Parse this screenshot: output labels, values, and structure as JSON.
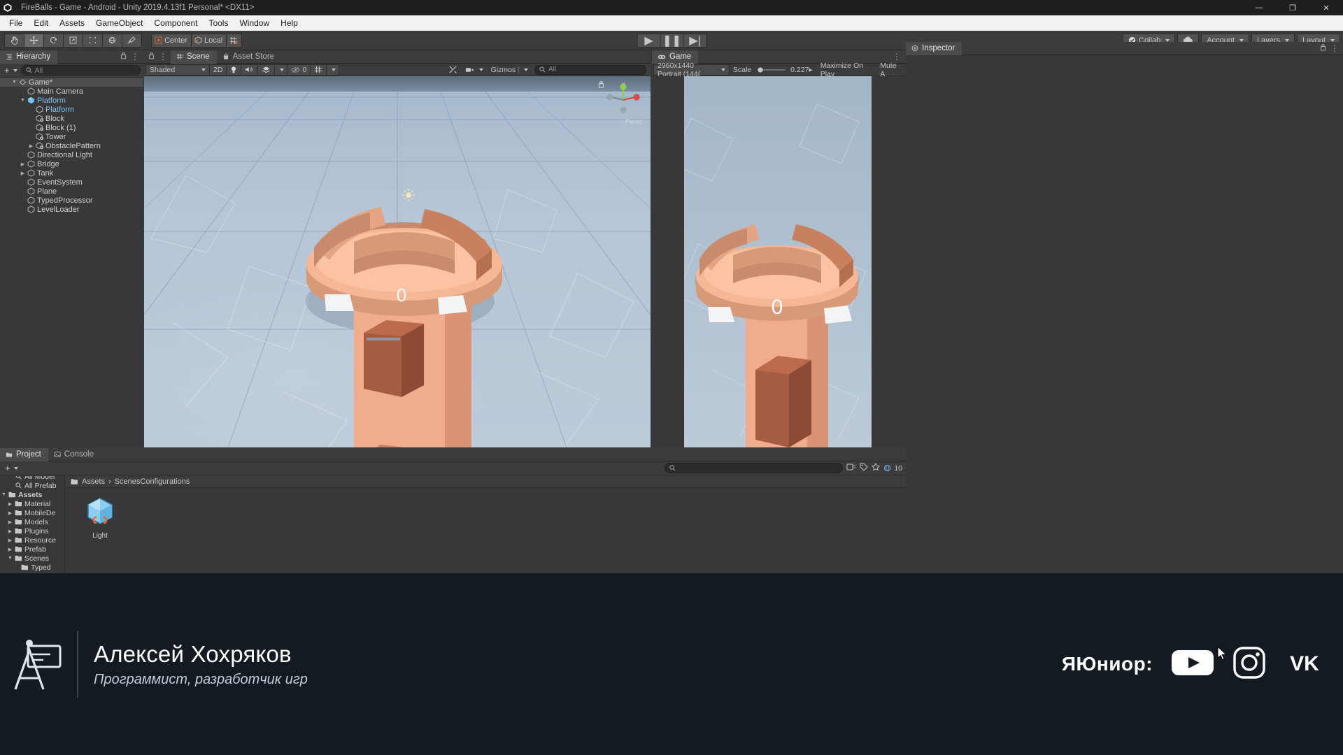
{
  "window": {
    "title": "FireBalls - Game - Android - Unity 2019.4.13f1 Personal* <DX11>",
    "app_icon": "unity-icon",
    "minimize": "—",
    "maximize": "❐",
    "close": "✕"
  },
  "menubar": {
    "items": [
      "File",
      "Edit",
      "Assets",
      "GameObject",
      "Component",
      "Tools",
      "Window",
      "Help"
    ]
  },
  "toolbar": {
    "tools": [
      {
        "name": "hand-tool-icon",
        "glyph": "✋"
      },
      {
        "name": "move-tool-icon",
        "glyph": "✥"
      },
      {
        "name": "rotate-tool-icon",
        "glyph": "↻"
      },
      {
        "name": "scale-tool-icon",
        "glyph": "⇲"
      },
      {
        "name": "rect-tool-icon",
        "glyph": "⬚"
      },
      {
        "name": "transform-tool-icon",
        "glyph": "⌘"
      },
      {
        "name": "custom-tool-icon",
        "glyph": "⚒"
      }
    ],
    "pivot_label": "Center",
    "space_label": "Local",
    "grid_snap_icon": "grid-snap-icon",
    "play": "▶",
    "pause": "❚❚",
    "step": "▶|",
    "collab_label": "Collab",
    "cloud_icon": "cloud-icon",
    "account_label": "Account",
    "layers_label": "Layers",
    "layout_label": "Layout"
  },
  "hierarchy": {
    "tab_label": "Hierarchy",
    "tab_icon": "hierarchy-icon",
    "add_label": "+",
    "search_placeholder": "All",
    "items": [
      {
        "label": "Game*",
        "depth": 0,
        "icon": "scene-icon",
        "arrow": "down",
        "selected": true,
        "prefab": false
      },
      {
        "label": "Main Camera",
        "depth": 1,
        "icon": "gameobject-icon",
        "arrow": "none",
        "selected": false,
        "prefab": false
      },
      {
        "label": "Platform",
        "depth": 1,
        "icon": "prefab-icon",
        "arrow": "down",
        "selected": false,
        "prefab": true
      },
      {
        "label": "Platform",
        "depth": 2,
        "icon": "gameobject-icon",
        "arrow": "none",
        "selected": false,
        "prefab": true
      },
      {
        "label": "Block",
        "depth": 2,
        "icon": "prefab-child-icon",
        "arrow": "none",
        "selected": false,
        "prefab": false
      },
      {
        "label": "Block (1)",
        "depth": 2,
        "icon": "prefab-child-icon",
        "arrow": "none",
        "selected": false,
        "prefab": false
      },
      {
        "label": "Tower",
        "depth": 2,
        "icon": "prefab-child-icon",
        "arrow": "none",
        "selected": false,
        "prefab": false
      },
      {
        "label": "ObstaclePattern",
        "depth": 2,
        "icon": "prefab-child-icon",
        "arrow": "right",
        "selected": false,
        "prefab": false
      },
      {
        "label": "Directional Light",
        "depth": 1,
        "icon": "gameobject-icon",
        "arrow": "none",
        "selected": false,
        "prefab": false
      },
      {
        "label": "Bridge",
        "depth": 1,
        "icon": "gameobject-icon",
        "arrow": "right",
        "selected": false,
        "prefab": false
      },
      {
        "label": "Tank",
        "depth": 1,
        "icon": "gameobject-icon",
        "arrow": "right",
        "selected": false,
        "prefab": false
      },
      {
        "label": "EventSystem",
        "depth": 1,
        "icon": "gameobject-icon",
        "arrow": "none",
        "selected": false,
        "prefab": false
      },
      {
        "label": "Plane",
        "depth": 1,
        "icon": "gameobject-icon",
        "arrow": "none",
        "selected": false,
        "prefab": false
      },
      {
        "label": "TypedProcessor",
        "depth": 1,
        "icon": "gameobject-icon",
        "arrow": "none",
        "selected": false,
        "prefab": false
      },
      {
        "label": "LevelLoader",
        "depth": 1,
        "icon": "gameobject-icon",
        "arrow": "none",
        "selected": false,
        "prefab": false
      }
    ]
  },
  "scene": {
    "tabs": [
      {
        "label": "Scene",
        "icon": "scene-tab-icon",
        "selected": true
      },
      {
        "label": "Asset Store",
        "icon": "asset-store-icon",
        "selected": false
      }
    ],
    "draw_mode": "Shaded",
    "mode_2d": "2D",
    "lighting_icon": "light-bulb-icon",
    "audio_icon": "audio-icon",
    "fx_icon": "effects-icon",
    "visibility_icon": "visibility-off-icon",
    "hidden_count": "0",
    "grid_icon": "grid-icon",
    "tools_icon": "scene-tools-icon",
    "camera_icon": "scene-camera-icon",
    "gizmos_label": "Gizmos",
    "search_placeholder": "All",
    "gizmo_axis_y": "y",
    "persp_label": "Persp",
    "overlay_number": "0"
  },
  "game": {
    "tab_label": "Game",
    "tab_icon": "game-tab-icon",
    "resolution": "2960x1440 Portrait (144(",
    "scale_label": "Scale",
    "scale_value": "0.227▸",
    "maximize_label": "Maximize On Play",
    "mute_label": "Mute A",
    "score_overlay": "0"
  },
  "inspector": {
    "tab_label": "Inspector",
    "tab_icon": "inspector-icon",
    "lock_icon": "lock-icon",
    "menu_icon": "kebab-menu-icon"
  },
  "project": {
    "tabs": [
      {
        "label": "Project",
        "icon": "project-icon",
        "selected": true
      },
      {
        "label": "Console",
        "icon": "console-icon",
        "selected": false
      }
    ],
    "add_label": "+",
    "search_placeholder": "",
    "count_badge": "10",
    "breadcrumb": [
      "Assets",
      "ScenesConfigurations"
    ],
    "tree": [
      {
        "label": "All Model",
        "depth": 1,
        "arrow": "none",
        "kind": "search",
        "cut": true
      },
      {
        "label": "All Prefab",
        "depth": 1,
        "arrow": "none",
        "kind": "search"
      },
      {
        "label": "Assets",
        "depth": 0,
        "arrow": "down",
        "kind": "folder",
        "bold": true
      },
      {
        "label": "Material",
        "depth": 1,
        "arrow": "right",
        "kind": "folder"
      },
      {
        "label": "MobileDe",
        "depth": 1,
        "arrow": "right",
        "kind": "folder"
      },
      {
        "label": "Models",
        "depth": 1,
        "arrow": "right",
        "kind": "folder"
      },
      {
        "label": "Plugins",
        "depth": 1,
        "arrow": "right",
        "kind": "folder"
      },
      {
        "label": "Resource",
        "depth": 1,
        "arrow": "right",
        "kind": "folder"
      },
      {
        "label": "Prefab",
        "depth": 1,
        "arrow": "right",
        "kind": "folder"
      },
      {
        "label": "Scenes",
        "depth": 1,
        "arrow": "down",
        "kind": "folder"
      },
      {
        "label": "Typed",
        "depth": 2,
        "arrow": "none",
        "kind": "folder"
      }
    ],
    "assets": [
      {
        "label": "Light",
        "icon": "prefab-cube-icon"
      }
    ]
  },
  "banner": {
    "logo_icon": "presenter-logo-icon",
    "name": "Алексей Хохряков",
    "role": "Программист, разработчик игр",
    "brand": "ЯЮниор:",
    "socials": [
      {
        "name": "youtube-icon"
      },
      {
        "name": "instagram-icon"
      },
      {
        "name": "vk-icon"
      }
    ]
  },
  "colors": {
    "unity_bg": "#383838",
    "toolbar_bg": "#3c3c3c",
    "platform_orange": "#f6b795",
    "platform_shade": "#c98b6d",
    "block_brown": "#a65c42",
    "banner_bg": "#141a21",
    "selection": "#4d4d4d"
  }
}
